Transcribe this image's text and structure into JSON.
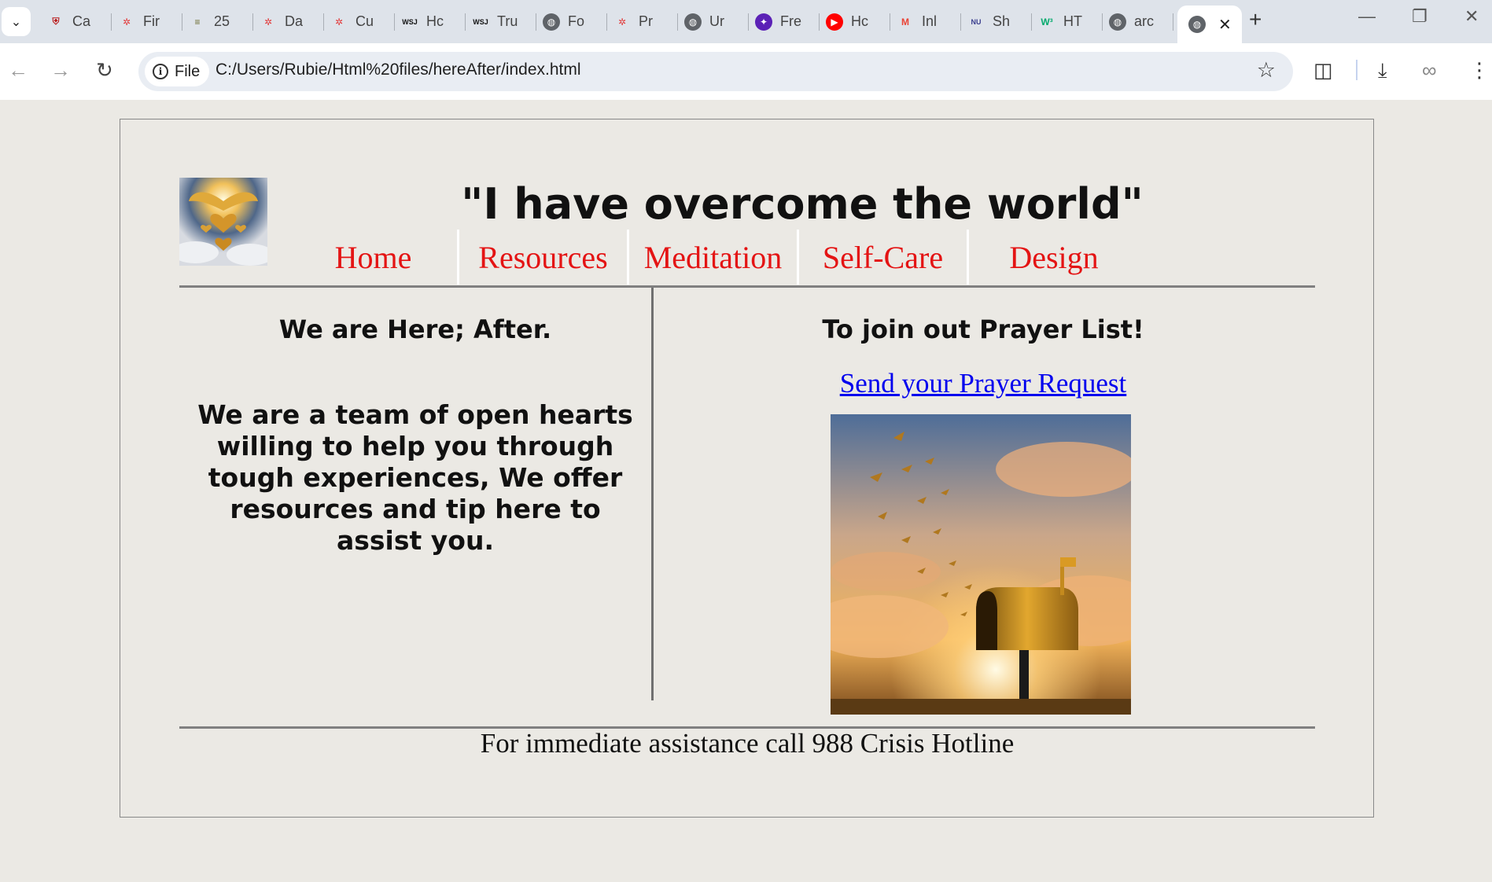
{
  "browser": {
    "tabs": [
      {
        "title": "Ca",
        "icon": "shield-icon",
        "color": "#b91c1c"
      },
      {
        "title": "Fir",
        "icon": "canvas-icon",
        "color": "#e23b3b"
      },
      {
        "title": "25",
        "icon": "books-icon",
        "color": "#6b6b2e"
      },
      {
        "title": "Da",
        "icon": "canvas-icon",
        "color": "#e23b3b"
      },
      {
        "title": "Cu",
        "icon": "canvas-icon",
        "color": "#e23b3b"
      },
      {
        "title": "Hc",
        "icon": "wsj-icon",
        "color": "#111111"
      },
      {
        "title": "Tru",
        "icon": "wsj-icon",
        "color": "#111111"
      },
      {
        "title": "Fo",
        "icon": "globe-icon",
        "color": "#5f6368"
      },
      {
        "title": "Pr",
        "icon": "canvas-icon",
        "color": "#e23b3b"
      },
      {
        "title": "Ur",
        "icon": "globe-icon",
        "color": "#5f6368"
      },
      {
        "title": "Fre",
        "icon": "star-icon",
        "color": "#5b21b6"
      },
      {
        "title": "Hc",
        "icon": "youtube-icon",
        "color": "#ff0000"
      },
      {
        "title": "Inl",
        "icon": "gmail-icon",
        "color": "#ea4335"
      },
      {
        "title": "Sh",
        "icon": "nu-icon",
        "color": "#3b3f8f"
      },
      {
        "title": "HT",
        "icon": "w3-icon",
        "color": "#04aa6d"
      },
      {
        "title": "arc",
        "icon": "globe-icon",
        "color": "#5f6368"
      }
    ],
    "active_tab_close": "✕",
    "new_tab": "+",
    "address_chip": "File",
    "url": "C:/Users/Rubie/Html%20files/hereAfter/index.html"
  },
  "page": {
    "headline": "\"I have overcome the world\"",
    "nav": [
      "Home",
      "Resources",
      "Meditation",
      "Self-Care",
      "Design"
    ],
    "left_heading": "We are Here; After.",
    "left_body": "We are a team of open hearts willing to help you through tough experiences, We offer resources and tip here to assist you.",
    "right_heading": "To join out Prayer List!",
    "prayer_link": "Send your Prayer Request",
    "footer": "For immediate assistance call 988 Crisis Hotline"
  },
  "colors": {
    "page_bg": "#ebe9e4",
    "nav_link": "#e41414",
    "hyperlink": "#0000ee"
  }
}
